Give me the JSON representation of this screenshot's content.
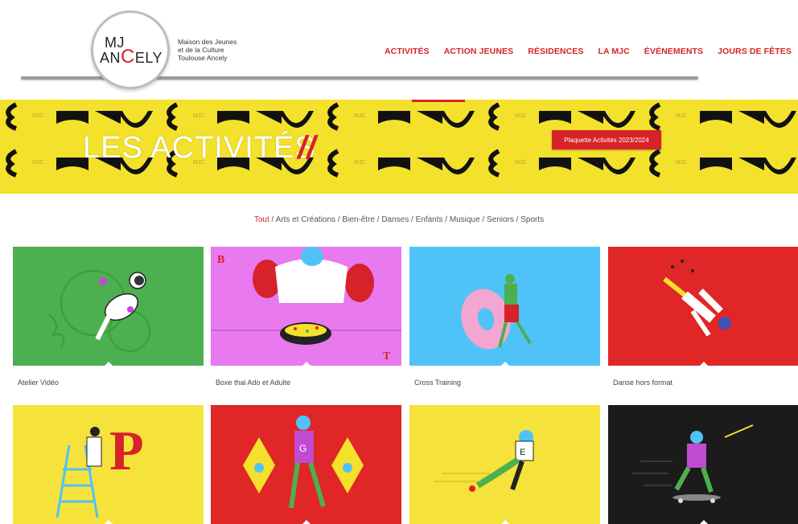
{
  "header": {
    "logo": {
      "line1": "MJ",
      "line2_pre": "AN",
      "line2_accent": "C",
      "line2_post": "ELY"
    },
    "tagline": [
      "Maison des Jeunes",
      "et de la Culture",
      "Toulouse Ancely"
    ],
    "nav": [
      "ACTIVITÉS",
      "ACTION JEUNES",
      "RÉSIDENCES",
      "LA MJC",
      "ÉVÉNEMENTS",
      "JOURS DE FÊTES"
    ]
  },
  "banner": {
    "title": "LES ACTIVITÉS",
    "slash": "//",
    "button": "Plaquette Activités 2023/2024"
  },
  "filters": {
    "items": [
      "Tout",
      "Arts et Créations",
      "Bien-être",
      "Danses",
      "Enfants",
      "Musique",
      "Seniors",
      "Sports"
    ],
    "active": "Tout"
  },
  "cards": [
    {
      "label": "Atelier Vidéo",
      "color": "#4caf50"
    },
    {
      "label": "Boxe thai Ado et Adulte",
      "color": "#e879ee"
    },
    {
      "label": "Cross Training",
      "color": "#4fc3f7"
    },
    {
      "label": "Danse hors format",
      "color": "#e02626"
    },
    {
      "label": "",
      "color": "#f5e23a"
    },
    {
      "label": "",
      "color": "#e02626"
    },
    {
      "label": "",
      "color": "#f5e23a"
    },
    {
      "label": "",
      "color": "#1b1b1b"
    }
  ],
  "colors": {
    "accent": "#d62228",
    "banner": "#f3e12c"
  }
}
